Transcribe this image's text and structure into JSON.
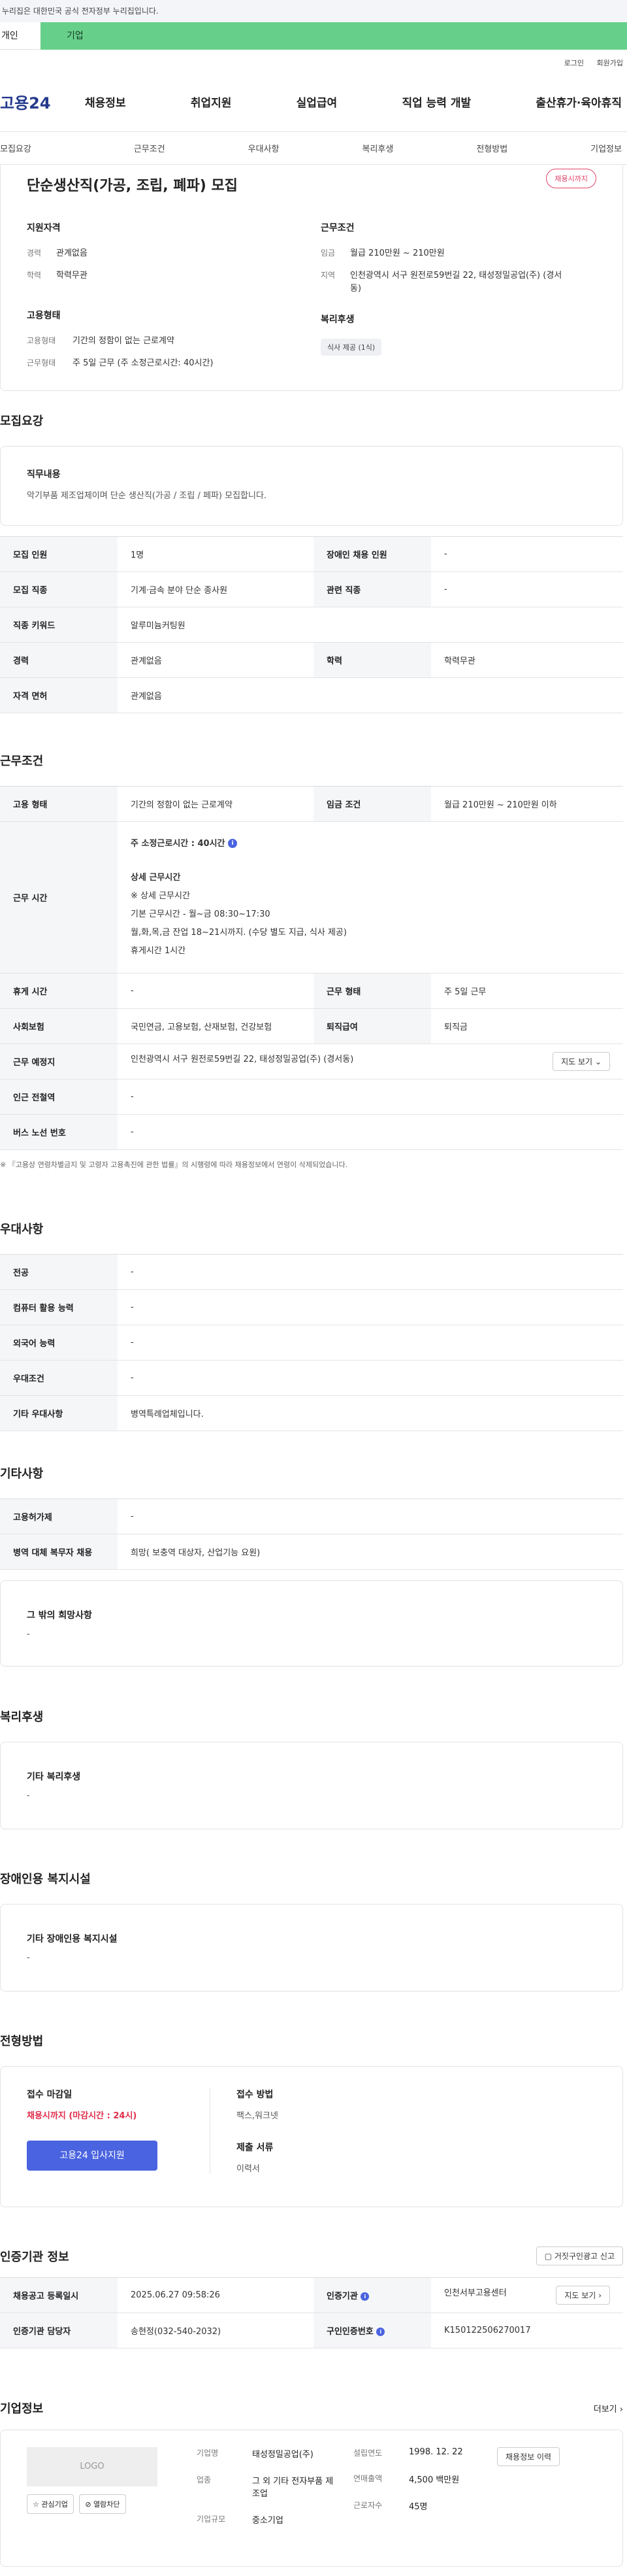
{
  "top": {
    "gov_notice": "이 누리집은 대한민국 공식 전자정부 누리집입니다.",
    "tab_person": "개인",
    "tab_company": "기업",
    "login": "로그인",
    "join": "회원가입"
  },
  "gnb": {
    "logo": "고용24",
    "menu": [
      "채용정보",
      "취업지원",
      "실업급여",
      "직업 능력 개발",
      "출산휴가·육아휴직"
    ]
  },
  "subnav": [
    "모집요강",
    "근무조건",
    "우대사항",
    "복리후생",
    "전형방법",
    "기업정보"
  ],
  "summary": {
    "title": "단순생산직(가공, 조립, 폐파) 모집",
    "badge": "채용시까지",
    "qual_title": "지원자격",
    "career_k": "경력",
    "career_v": "관계없음",
    "edu_k": "학력",
    "edu_v": "학력무관",
    "emp_title": "고용형태",
    "emp1_k": "고용형태",
    "emp1_v": "기간의 정함이 없는 근로계약",
    "emp2_k": "근무형태",
    "emp2_v": "주 5일 근무 (주 소정근로시간: 40시간)",
    "cond_title": "근무조건",
    "pay_k": "임금",
    "pay_v": "월급 210만원 ~ 210만원",
    "loc_k": "지역",
    "loc_v": "인천광역시 서구 원전로59번길 22, 태성정밀공업(주) (경서동)",
    "welfare_title": "복리후생",
    "welfare_chip": "식사 제공 (1식)"
  },
  "recruit": {
    "title": "모집요강",
    "duty_label": "직무내용",
    "duty_text": "악기부품 제조업체이며 단순 생산직(가공 / 조립 / 페파) 모집합니다.",
    "rows": [
      [
        "모집 인원",
        "1명",
        "장애인 채용 인원",
        "-"
      ],
      [
        "모집 직종",
        "기계·금속 분야 단순 종사원",
        "관련 직종",
        "-"
      ],
      [
        "직종 키워드",
        "알루미늄커팅원",
        "",
        ""
      ],
      [
        "경력",
        "관계없음",
        "학력",
        "학력무관"
      ],
      [
        "자격 면허",
        "관계없음",
        "",
        ""
      ]
    ]
  },
  "work": {
    "title": "근무조건",
    "emp_k": "고용 형태",
    "emp_v": "기간의 정함이 없는 근로계약",
    "pay_k": "임금 조건",
    "pay_v": "월급 210만원 ~ 210만원 이하",
    "hours_k": "근무 시간",
    "hours_main": "주 소정근로시간 : 40시간",
    "hours_detail_title": "상세 근무시간",
    "hours_lines": [
      "※ 상세 근무시간",
      "기본 근무시간 - 월~금 08:30~17:30",
      "월,화,목,금 잔업 18~21시까지. (수당 별도 지급, 식사 제공)",
      "휴게시간 1시간"
    ],
    "rest_k": "휴게 시간",
    "rest_v": "-",
    "shift_k": "근무 형태",
    "shift_v": "주 5일 근무",
    "ins_k": "사회보험",
    "ins_v": "국민연금, 고용보험, 산재보험, 건강보험",
    "sev_k": "퇴직급여",
    "sev_v": "퇴직금",
    "place_k": "근무 예정지",
    "place_v": "인천광역시 서구 원전로59번길 22, 태성정밀공업(주) (경서동)",
    "map_btn": "지도 보기",
    "station_k": "인근 전철역",
    "station_v": "-",
    "bus_k": "버스 노선 번호",
    "bus_v": "-",
    "note": "※ 『고용상 연령차별금지 및 고령자 고용촉진에 관한 법률』의 시행령에 따라 채용정보에서 연령이 삭제되었습니다."
  },
  "pref": {
    "title": "우대사항",
    "rows": [
      [
        "전공",
        "-"
      ],
      [
        "컴퓨터 활용 능력",
        "-"
      ],
      [
        "외국어 능력",
        "-"
      ],
      [
        "우대조건",
        "-"
      ],
      [
        "기타 우대사항",
        "병역특례업체입니다."
      ]
    ]
  },
  "etc": {
    "title": "기타사항",
    "rows": [
      [
        "고용허가제",
        "-"
      ],
      [
        "병역 대체 복무자 채용",
        "희망( 보충역 대상자, 산업기능 요원)"
      ]
    ],
    "other_label": "그 밖의 희망사항",
    "other_value": "-"
  },
  "welfare": {
    "title": "복리후생",
    "label": "기타 복리후생",
    "value": "-"
  },
  "disabled": {
    "title": "장애인용 복지시설",
    "label": "기타 장애인용 복지시설",
    "value": "-"
  },
  "screening": {
    "title": "전형방법",
    "deadline_label": "접수 마감일",
    "deadline_value": "채용시까지 (마감시간 : 24시)",
    "apply_btn": "고용24 입사지원",
    "method_label": "접수 방법",
    "method_value": "팩스,워크넷",
    "docs_label": "제출 서류",
    "docs_value": "이력서"
  },
  "agency": {
    "title": "인증기관 정보",
    "report_btn": "거짓구인광고 신고",
    "reg_k": "채용공고 등록일시",
    "reg_v": "2025.06.27 09:58:26",
    "org_k": "인증기관",
    "org_v": "인천서부고용센터",
    "map_btn": "지도 보기",
    "manager_k": "인증기관 담당자",
    "manager_v": "송현정(032-540-2032)",
    "num_k": "구인인증번호",
    "num_v": "K150122506270017"
  },
  "company": {
    "title": "기업정보",
    "more": "더보기",
    "logo": "LOGO",
    "fav_btn": "관심기업",
    "block_btn": "열람차단",
    "name_k": "기업명",
    "name_v": "태성정밀공업(주)",
    "biz_k": "업종",
    "biz_v": "그 외 기타 전자부품 제조업",
    "size_k": "기업규모",
    "size_v": "중소기업",
    "year_k": "설립연도",
    "year_v": "1998. 12. 22",
    "sales_k": "연매출액",
    "sales_v": "4,500 백만원",
    "emp_k": "근로자수",
    "emp_v": "45명",
    "hist_btn": "채용정보 이력"
  }
}
